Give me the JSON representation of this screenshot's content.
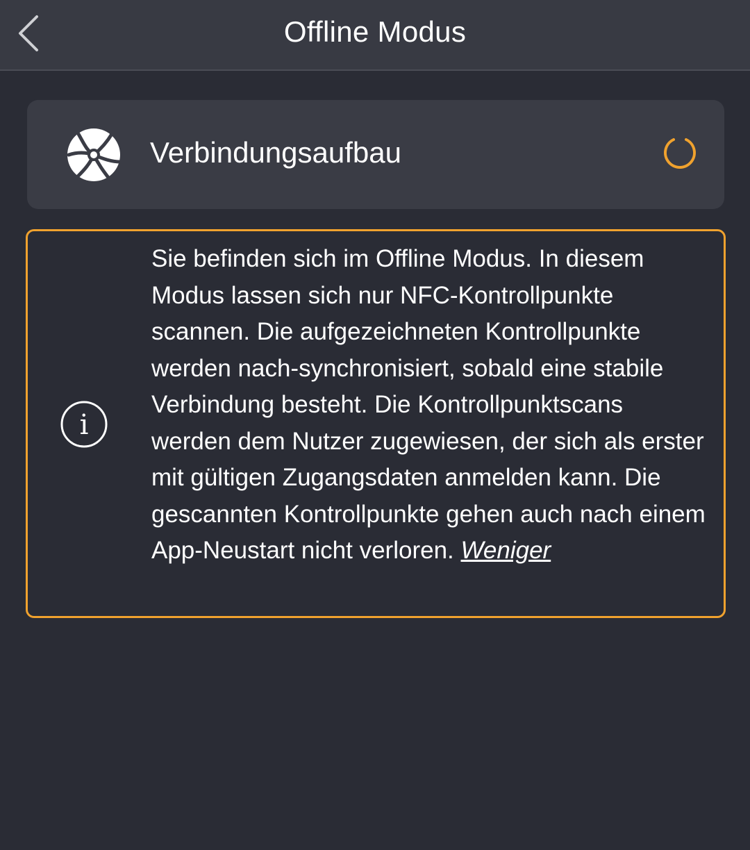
{
  "header": {
    "title": "Offline Modus"
  },
  "connection": {
    "label": "Verbindungsaufbau",
    "spinner_color": "#f0a22e"
  },
  "info": {
    "text": "Sie befinden sich im Offline Modus. In diesem Modus lassen sich nur NFC-Kontrollpunkte scannen. Die aufgezeichneten Kontrollpunkte werden nach-synchronisiert, sobald eine stabile Verbindung besteht. Die Kontrollpunktscans werden dem Nutzer zugewiesen, der sich als erster mit gültigen Zugangsdaten anmelden kann. Die gescannten Kontrollpunkte gehen auch nach einem App-Neustart nicht verloren.",
    "less_link": "Weniger",
    "border_color": "#f0a22e"
  },
  "icons": {
    "back": "chevron-left-icon",
    "globe": "globe-network-icon",
    "spinner": "loading-spinner-icon",
    "info": "info-icon"
  }
}
